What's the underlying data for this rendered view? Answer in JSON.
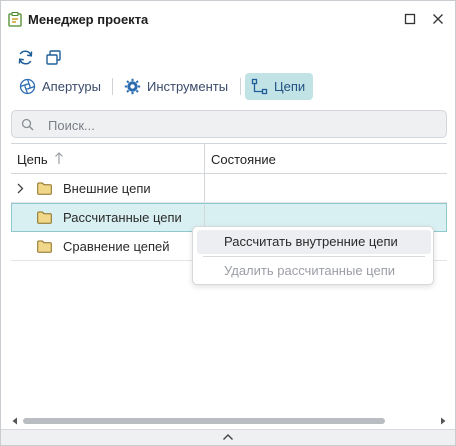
{
  "window": {
    "title": "Менеджер проекта"
  },
  "tabs": [
    {
      "label": "Апертуры",
      "icon": "aperture-icon",
      "active": false
    },
    {
      "label": "Инструменты",
      "icon": "gear-icon",
      "active": false
    },
    {
      "label": "Цепи",
      "icon": "nets-icon",
      "active": true
    }
  ],
  "search": {
    "placeholder": "Поиск..."
  },
  "table": {
    "columns": [
      "Цепь",
      "Состояние"
    ],
    "rows": [
      {
        "label": "Внешние цепи",
        "expandable": true,
        "selected": false
      },
      {
        "label": "Рассчитанные цепи",
        "expandable": false,
        "selected": true
      },
      {
        "label": "Сравнение цепей",
        "expandable": false,
        "selected": false
      }
    ]
  },
  "context_menu": {
    "items": [
      {
        "label": "Рассчитать внутренние цепи",
        "enabled": true
      },
      {
        "label": "Удалить рассчитанные цепи",
        "enabled": false
      }
    ]
  },
  "colors": {
    "accent": "#c2e3e6",
    "selection": "#d8f0f1",
    "folder": "#f0d78a"
  }
}
